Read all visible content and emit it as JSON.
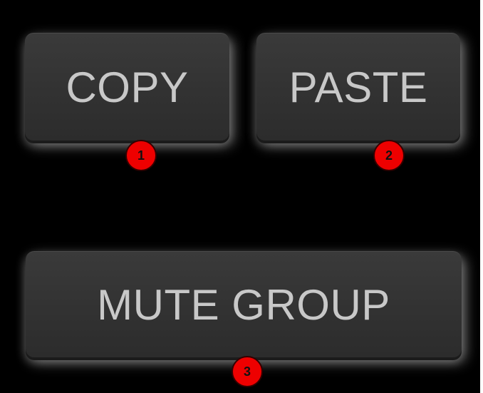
{
  "buttons": {
    "copy_label": "COPY",
    "paste_label": "PASTE",
    "mute_group_label": "MUTE GROUP"
  },
  "annotations": {
    "copy_marker": "1",
    "paste_marker": "2",
    "mute_group_marker": "3",
    "marker_color": "#ee0000"
  },
  "theme": {
    "panel_background": "#000000",
    "button_color": "#333333",
    "label_color": "#c8c8c8"
  }
}
